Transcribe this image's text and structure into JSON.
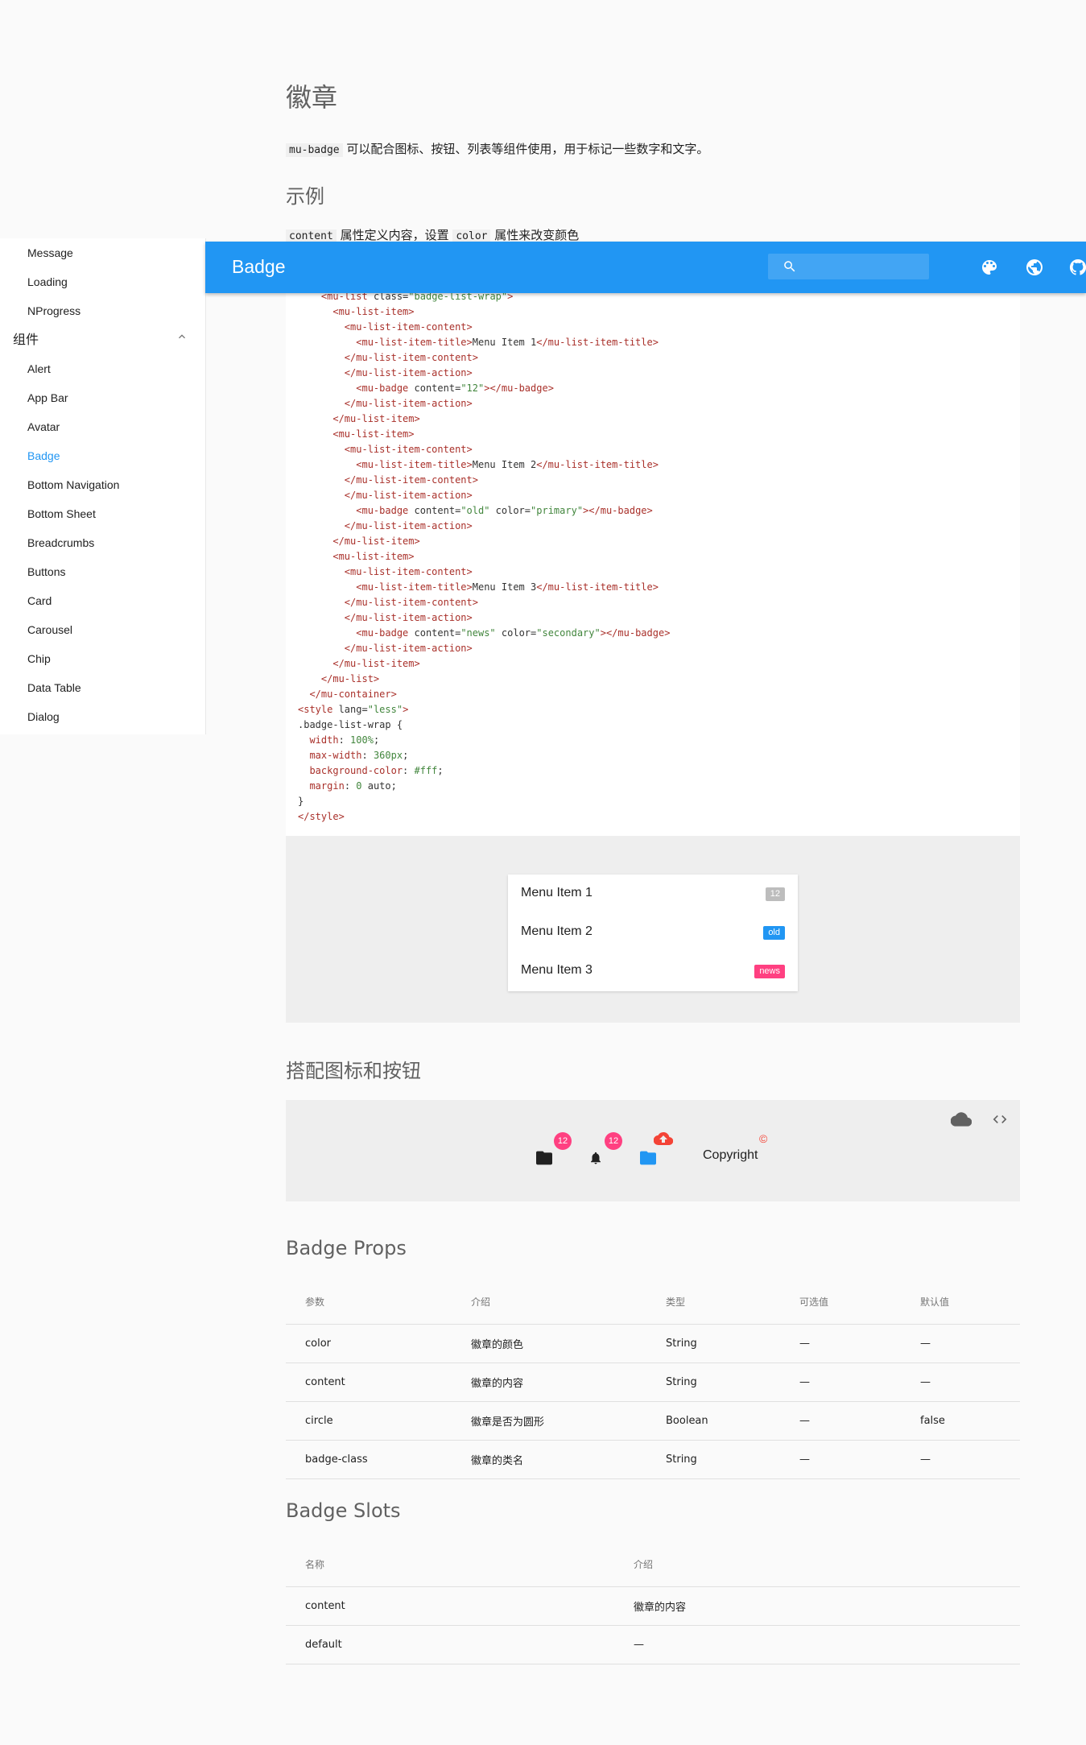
{
  "page": {
    "title": "徽章",
    "intro_code": "mu-badge",
    "intro_text": " 可以配合图标、按钮、列表等组件使用，用于标记一些数字和文字。",
    "example_heading": "示例",
    "example_code1": "content",
    "example_text1": " 属性定义内容，设置 ",
    "example_code2": "color",
    "example_text2": " 属性来改变颜色"
  },
  "sidebar": {
    "items_top": [
      "Message",
      "Loading",
      "NProgress"
    ],
    "group_label": "组件",
    "items": [
      "Alert",
      "App Bar",
      "Avatar",
      "Badge",
      "Bottom Navigation",
      "Bottom Sheet",
      "Breadcrumbs",
      "Buttons",
      "Card",
      "Carousel",
      "Chip",
      "Data Table",
      "Dialog"
    ],
    "active": "Badge"
  },
  "appbar": {
    "title": "Badge",
    "search_placeholder": "",
    "icons": [
      "palette-icon",
      "globe-icon",
      "github-icon"
    ]
  },
  "demo1": {
    "rows": [
      {
        "label": "Menu Item 1",
        "badge": "12",
        "color": "#bdbdbd"
      },
      {
        "label": "Menu Item 2",
        "badge": "old",
        "color": "#2196f3"
      },
      {
        "label": "Menu Item 3",
        "badge": "news",
        "color": "#ff4081"
      }
    ]
  },
  "demo2": {
    "heading": "搭配图标和按钮",
    "badge1": "12",
    "badge2": "12",
    "copyright_label": "Copyright",
    "copyright_mark": "©"
  },
  "props": {
    "heading": "Badge Props",
    "columns": [
      "参数",
      "介绍",
      "类型",
      "可选值",
      "默认值"
    ],
    "rows": [
      [
        "color",
        "徽章的颜色",
        "String",
        "—",
        "—"
      ],
      [
        "content",
        "徽章的内容",
        "String",
        "—",
        "—"
      ],
      [
        "circle",
        "徽章是否为圆形",
        "Boolean",
        "—",
        "false"
      ],
      [
        "badge-class",
        "徽章的类名",
        "String",
        "—",
        "—"
      ]
    ]
  },
  "slots": {
    "heading": "Badge Slots",
    "columns": [
      "名称",
      "介绍"
    ],
    "rows": [
      [
        "content",
        "徽章的内容"
      ],
      [
        "default",
        "—"
      ]
    ]
  },
  "colors": {
    "primary": "#2196f3",
    "secondary": "#ff4081",
    "default_badge": "#bdbdbd"
  }
}
